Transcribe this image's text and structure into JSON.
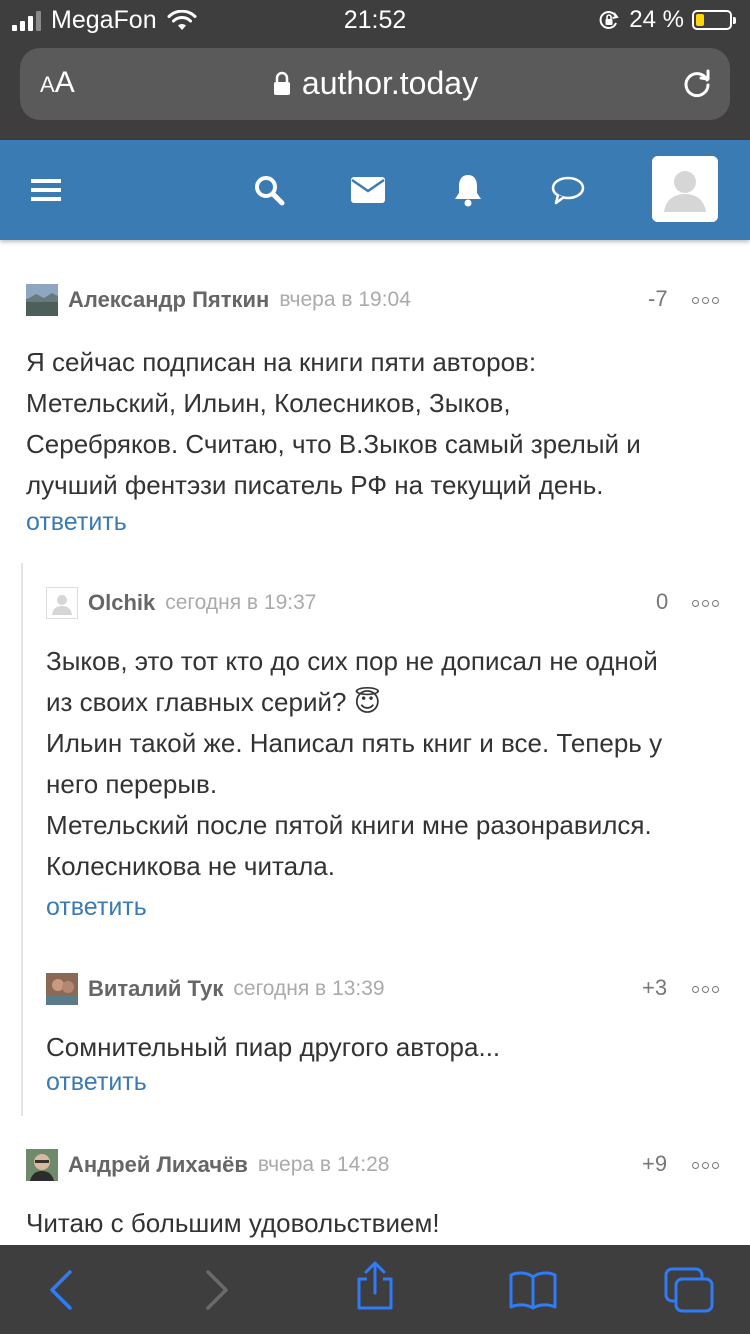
{
  "status_bar": {
    "carrier": "MegaFon",
    "time": "21:52",
    "battery_percent": "24 %",
    "battery_level": 0.24,
    "battery_color": "#ffd60a"
  },
  "browser": {
    "text_size_small": "A",
    "text_size_large": "A",
    "url": "author.today",
    "icons": [
      "wifi-icon",
      "lock-icon",
      "reload-icon",
      "orientation-lock-icon"
    ]
  },
  "site_header": {
    "bg_color": "#3b7bb3",
    "icons": [
      "menu-icon",
      "search-icon",
      "mail-icon",
      "bell-icon",
      "chat-icon",
      "user-avatar"
    ]
  },
  "comments": [
    {
      "author": "Александр Пяткин",
      "time": "вчера в 19:04",
      "score": "-7",
      "lines": [
        "Я сейчас подписан на книги пяти авторов:",
        "Метельский, Ильин, Колесников, Зыков,",
        "Серебряков. Считаю, что В.Зыков самый зрелый и",
        "лучший фентэзи писатель РФ на текущий день."
      ],
      "reply": "ответить"
    },
    {
      "author": "Olchik",
      "time": "сегодня в 19:37",
      "score": "0",
      "lines": [
        "Зыков, это тот кто до сих пор не дописал не одной",
        "из своих главных серий?",
        "Ильин такой же. Написал пять книг и все. Теперь у",
        "него перерыв.",
        "Метельский после пятой книги мне разонравился.",
        "Колесникова не читала."
      ],
      "emoji": "😇",
      "reply": "ответить"
    },
    {
      "author": "Виталий Тук",
      "time": "сегодня в 13:39",
      "score": "+3",
      "lines": [
        "Сомнительный пиар другого автора..."
      ],
      "reply": "ответить"
    },
    {
      "author": "Андрей Лихачёв",
      "time": "вчера в 14:28",
      "score": "+9",
      "lines": [
        "Читаю с большим удовольствием!"
      ]
    }
  ],
  "toolbar": {
    "accent_color": "#2f7cf6",
    "icons": [
      "back-icon",
      "forward-icon",
      "share-icon",
      "bookmarks-icon",
      "tabs-icon"
    ]
  }
}
